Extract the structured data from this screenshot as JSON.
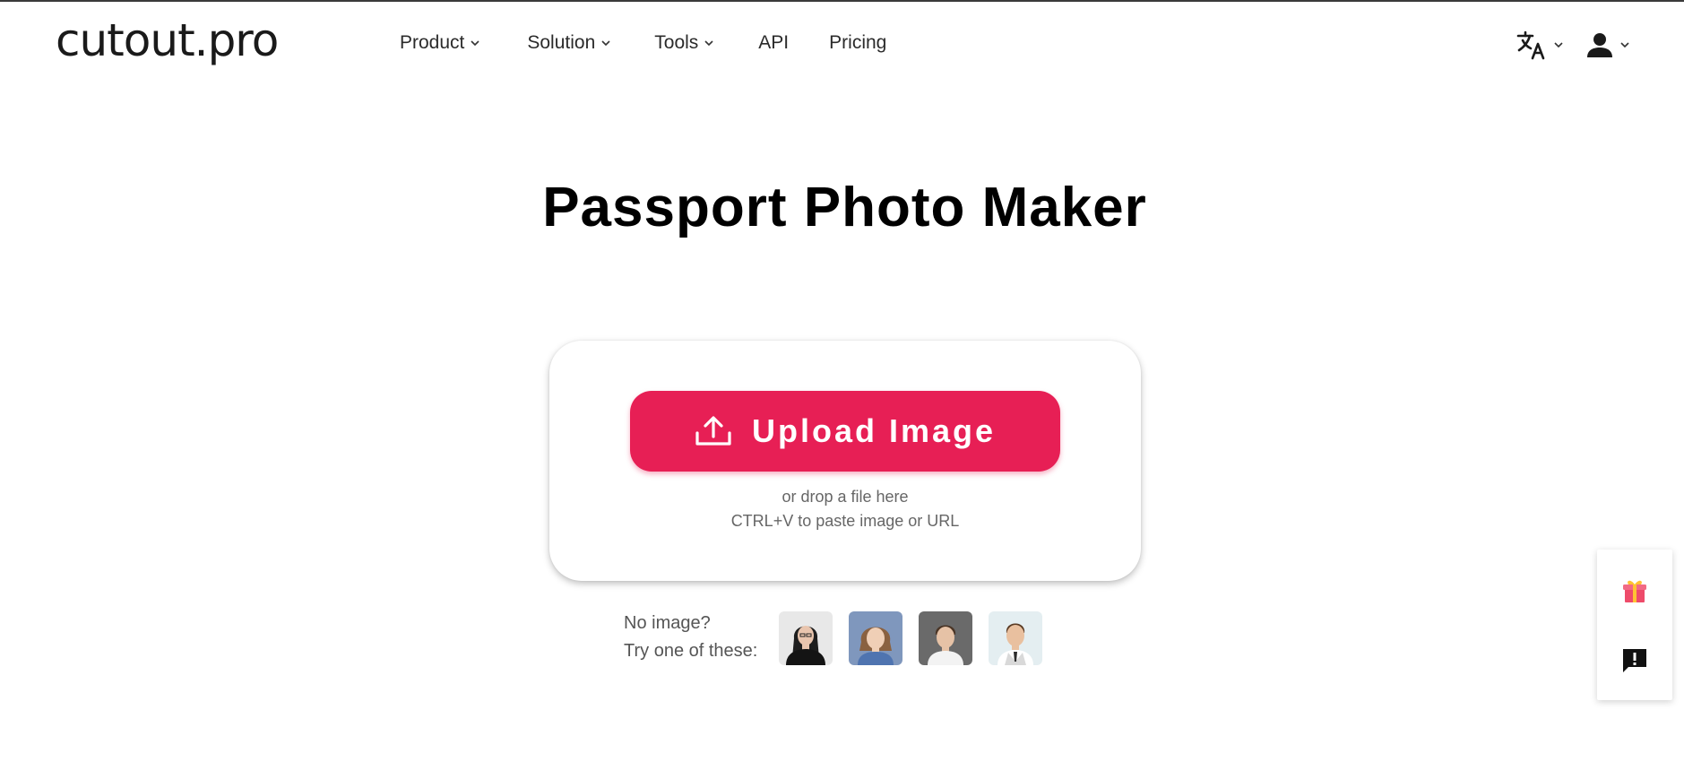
{
  "header": {
    "logo_text": "cutout.pro",
    "nav": [
      {
        "label": "Product",
        "has_dropdown": true
      },
      {
        "label": "Solution",
        "has_dropdown": true
      },
      {
        "label": "Tools",
        "has_dropdown": true
      },
      {
        "label": "API",
        "has_dropdown": false
      },
      {
        "label": "Pricing",
        "has_dropdown": false
      }
    ],
    "language_icon": "translate-icon",
    "account_icon": "user-icon"
  },
  "main": {
    "title": "Passport Photo Maker",
    "upload": {
      "button_label": "Upload Image",
      "button_icon": "upload-icon",
      "drop_hint": "or drop a file here",
      "paste_hint": "CTRL+V to paste image or URL"
    },
    "samples": {
      "line1": "No image?",
      "line2": "Try one of these:",
      "thumbnails": [
        "sample-woman-portrait",
        "sample-girl-portrait",
        "sample-boy-portrait",
        "sample-boy-vest-portrait"
      ]
    }
  },
  "side_widget": {
    "gift_icon": "gift-icon",
    "feedback_icon": "feedback-icon"
  },
  "colors": {
    "accent": "#e71f55",
    "text": "#2b2b2b",
    "background": "#ffffff"
  }
}
